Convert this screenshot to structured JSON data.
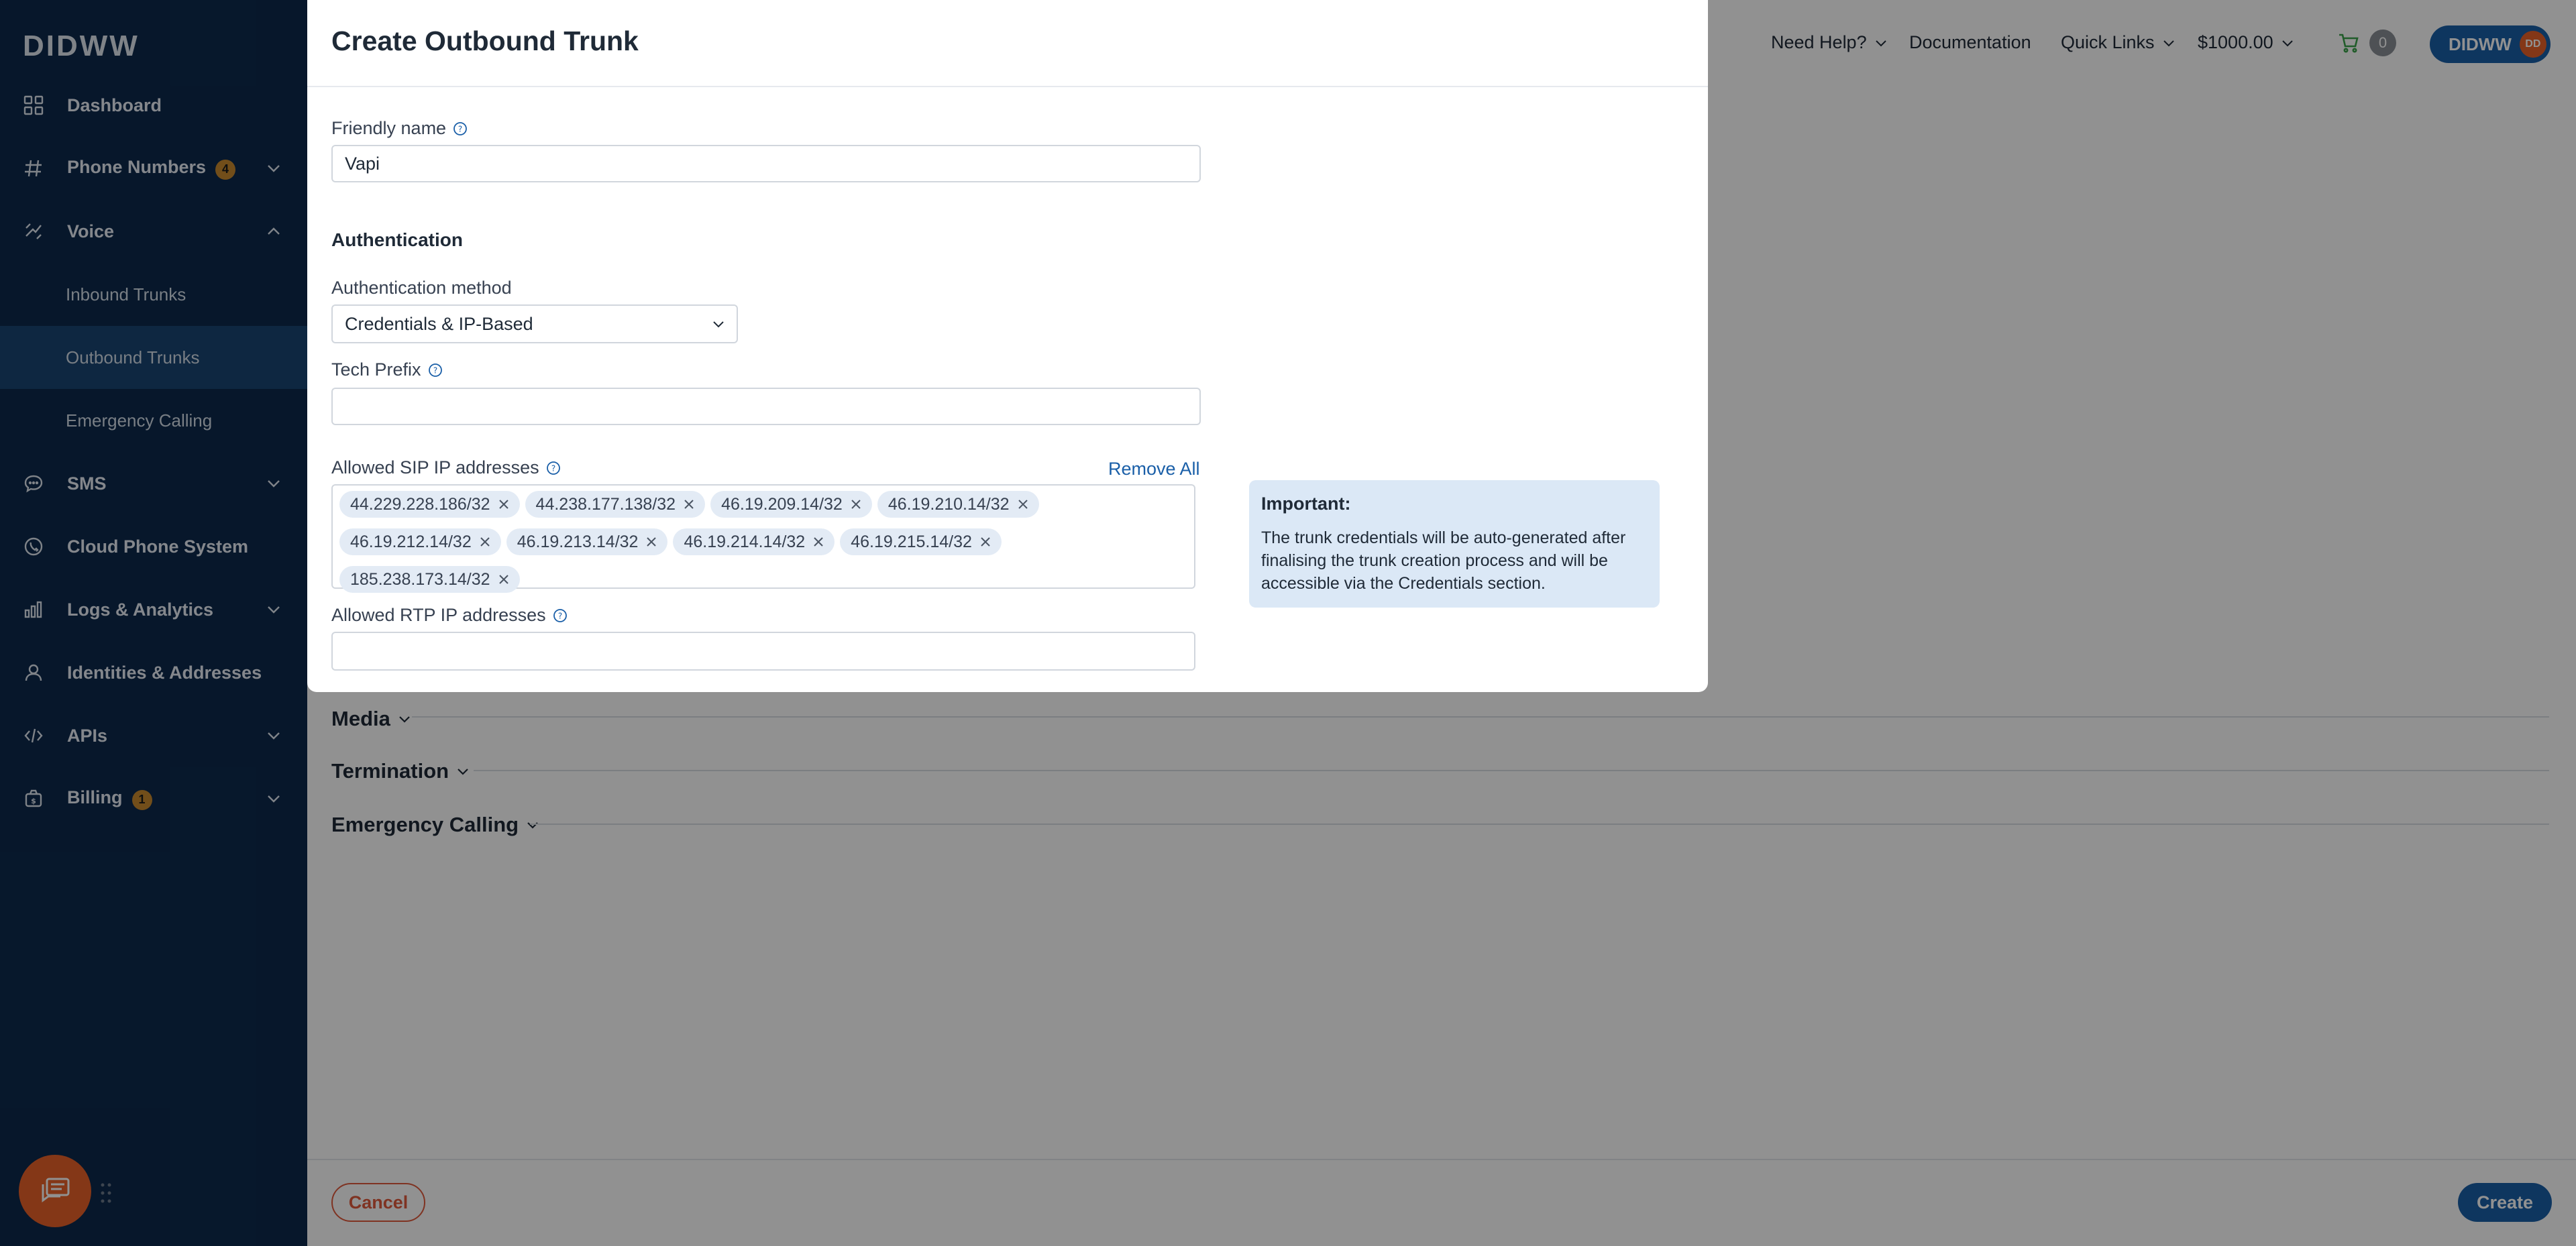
{
  "sidebar": {
    "logo": "DIDWW",
    "items": [
      {
        "label": "Dashboard",
        "icon": "dashboard-grid-icon"
      },
      {
        "label": "Phone Numbers",
        "badge": "4",
        "icon": "hash-icon"
      },
      {
        "label": "Voice",
        "icon": "voice-icon"
      },
      {
        "label": "Inbound Trunks"
      },
      {
        "label": "Outbound Trunks"
      },
      {
        "label": "Emergency Calling"
      },
      {
        "label": "SMS",
        "icon": "sms-icon"
      },
      {
        "label": "Cloud Phone System",
        "icon": "cloud-phone-icon"
      },
      {
        "label": "Logs & Analytics",
        "icon": "chart-icon"
      },
      {
        "label": "Identities & Addresses",
        "icon": "user-icon"
      },
      {
        "label": "APIs",
        "icon": "code-icon"
      },
      {
        "label": "Billing",
        "badge": "1",
        "icon": "billing-icon"
      }
    ]
  },
  "topbar": {
    "help": "Need Help?",
    "documentation": "Documentation",
    "quick_links": "Quick Links",
    "balance": "$1000.00",
    "cart_count": "0",
    "account": "DIDWW",
    "avatar": "DD"
  },
  "page": {
    "sections": [
      "Media",
      "Termination",
      "Emergency Calling"
    ],
    "cancel": "Cancel",
    "create": "Create"
  },
  "modal": {
    "title": "Create Outbound Trunk",
    "friendly_name_label": "Friendly name",
    "friendly_name_value": "Vapi",
    "auth_heading": "Authentication",
    "auth_method_label": "Authentication method",
    "auth_method_value": "Credentials & IP-Based",
    "tech_prefix_label": "Tech Prefix",
    "tech_prefix_value": "",
    "sip_label": "Allowed SIP IP addresses",
    "remove_all": "Remove All",
    "sip_ips": [
      "44.229.228.186/32",
      "44.238.177.138/32",
      "46.19.209.14/32",
      "46.19.210.14/32",
      "46.19.212.14/32",
      "46.19.213.14/32",
      "46.19.214.14/32",
      "46.19.215.14/32",
      "185.238.173.14/32"
    ],
    "rtp_label": "Allowed RTP IP addresses",
    "rtp_value": "",
    "important_title": "Important:",
    "important_text": "The trunk credentials will be auto-generated after finalising the trunk creation process and will be accessible via the Credentials section."
  },
  "colors": {
    "sidebar_bg": "#0d2a4d",
    "accent": "#1a5fa8",
    "danger": "#e05a3c",
    "badge": "#c88a2e",
    "info_bg": "#dbe8f6"
  }
}
